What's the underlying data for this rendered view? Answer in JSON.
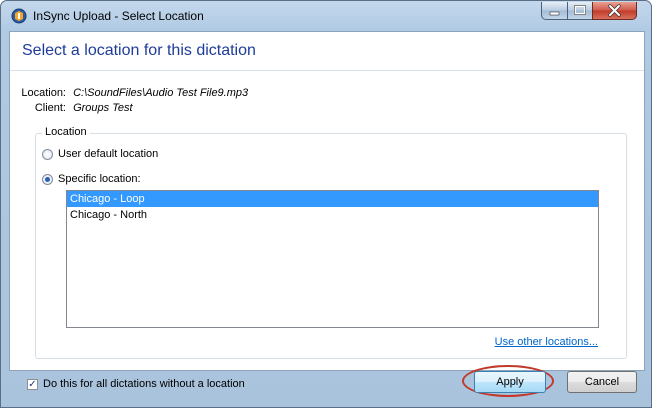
{
  "window": {
    "title": "InSync Upload - Select Location"
  },
  "dialog": {
    "heading": "Select a location for this dictation",
    "location_label": "Location:",
    "location_value": "C:\\SoundFiles\\Audio Test File9.mp3",
    "client_label": "Client:",
    "client_value": "Groups Test"
  },
  "location_group": {
    "title": "Location",
    "options": [
      {
        "label": "User default location",
        "checked": false
      },
      {
        "label": "Specific location:",
        "checked": true
      }
    ],
    "list_items": [
      {
        "label": "Chicago - Loop",
        "selected": true
      },
      {
        "label": "Chicago - North",
        "selected": false
      }
    ],
    "other_link": "Use other locations..."
  },
  "footer": {
    "checkbox_label": "Do this for all dictations without a location",
    "checkbox_checked": true,
    "apply_label": "Apply",
    "cancel_label": "Cancel"
  },
  "colors": {
    "heading": "#1e3c9a",
    "selection": "#3399ff",
    "link": "#0066cc",
    "highlight_ring": "#c0392b"
  },
  "icons": {
    "app": "insync-app-icon",
    "minimize": "minimize-icon",
    "maximize": "maximize-icon",
    "close": "close-icon"
  }
}
